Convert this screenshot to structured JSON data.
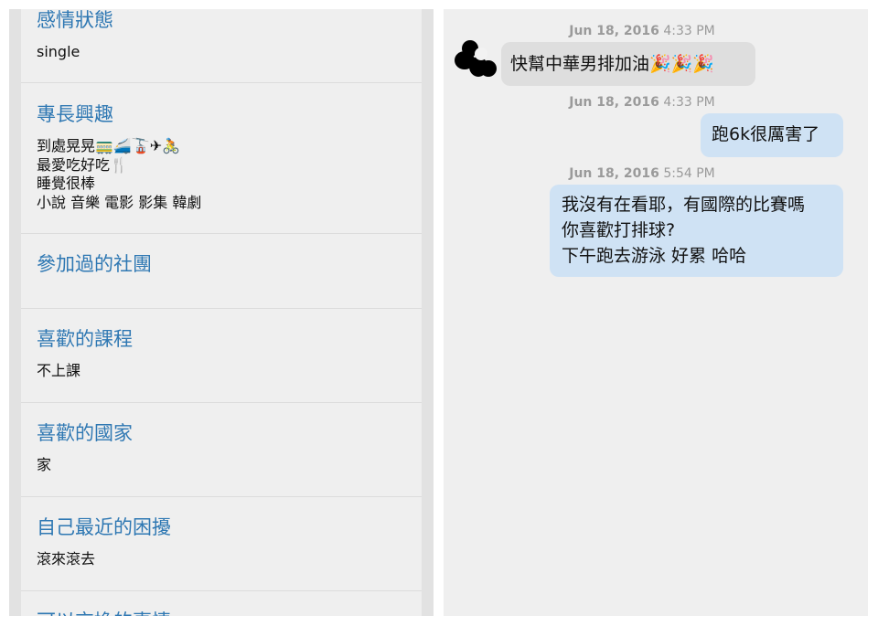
{
  "profile": {
    "sections": [
      {
        "title": "感情狀態",
        "body": "single"
      },
      {
        "title": "專長興趣",
        "body": "到處晃晃🚃🚄🚡✈🚴\n最愛吃好吃🍴\n睡覺很棒\n小說 音樂 電影 影集 韓劇"
      },
      {
        "title": "參加過的社團",
        "body": ""
      },
      {
        "title": "喜歡的課程",
        "body": "不上課"
      },
      {
        "title": "喜歡的國家",
        "body": "家"
      },
      {
        "title": "自己最近的困擾",
        "body": "滾來滾去"
      },
      {
        "title": "可以交換的事情",
        "body": ""
      }
    ]
  },
  "chat": {
    "messages": [
      {
        "date": "Jun 18, 2016",
        "time": "4:33 PM",
        "direction": "incoming",
        "text": "快幫中華男排加油🎉🎉🎉"
      },
      {
        "date": "Jun 18, 2016",
        "time": "4:33 PM",
        "direction": "outgoing",
        "text": "跑6k很厲害了"
      },
      {
        "date": "Jun 18, 2016",
        "time": "5:54 PM",
        "direction": "outgoing",
        "text": "我沒有在看耶，有國際的比賽嗎\n你喜歡打排球?\n下午跑去游泳 好累 哈哈"
      }
    ]
  },
  "colors": {
    "section_title": "#2f78b3",
    "incoming_bubble": "#dedede",
    "outgoing_bubble": "#cfe2f4",
    "timestamp": "#9a9a9a",
    "panel_background": "#efefef"
  }
}
